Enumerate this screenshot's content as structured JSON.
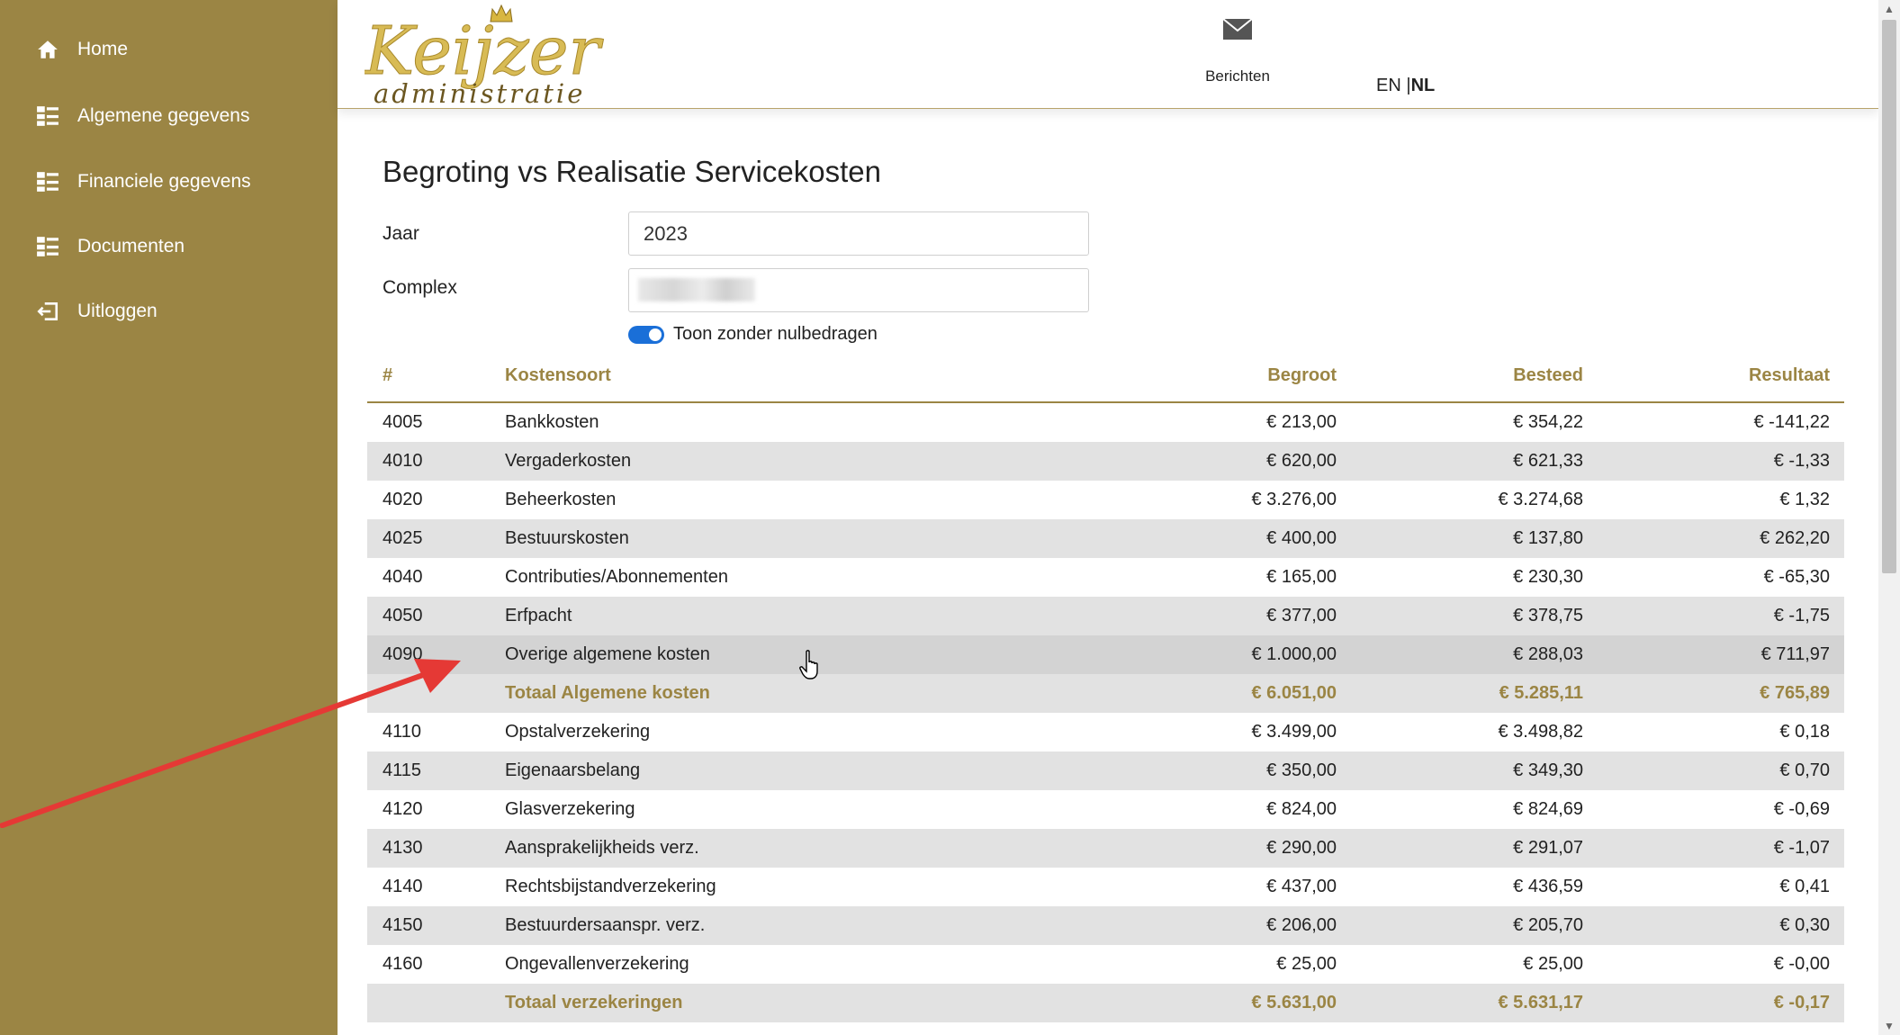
{
  "sidebar": {
    "items": [
      {
        "label": "Home",
        "icon": "home-icon"
      },
      {
        "label": "Algemene gegevens",
        "icon": "list-icon"
      },
      {
        "label": "Financiele gegevens",
        "icon": "list-icon"
      },
      {
        "label": "Documenten",
        "icon": "list-icon"
      },
      {
        "label": "Uitloggen",
        "icon": "logout-icon"
      }
    ],
    "color": "#9b8544"
  },
  "header": {
    "logo_line1": "Keijzer",
    "logo_line2": "administratie",
    "messages_label": "Berichten",
    "lang_en": "EN",
    "lang_sep": " |",
    "lang_nl": "NL"
  },
  "main": {
    "title": "Begroting vs Realisatie Servicekosten",
    "year_label": "Jaar",
    "year_value": "2023",
    "complex_label": "Complex",
    "toggle_label": "Toon zonder nulbedragen",
    "toggle_on": true
  },
  "table": {
    "headers": {
      "num": "#",
      "name": "Kostensoort",
      "begroot": "Begroot",
      "besteed": "Besteed",
      "resultaat": "Resultaat"
    },
    "rows": [
      {
        "num": "4005",
        "name": "Bankkosten",
        "begroot": "€ 213,00",
        "besteed": "€ 354,22",
        "resultaat": "€ -141,22"
      },
      {
        "num": "4010",
        "name": "Vergaderkosten",
        "begroot": "€ 620,00",
        "besteed": "€ 621,33",
        "resultaat": "€ -1,33"
      },
      {
        "num": "4020",
        "name": "Beheerkosten",
        "begroot": "€ 3.276,00",
        "besteed": "€ 3.274,68",
        "resultaat": "€ 1,32"
      },
      {
        "num": "4025",
        "name": "Bestuurskosten",
        "begroot": "€ 400,00",
        "besteed": "€ 137,80",
        "resultaat": "€ 262,20"
      },
      {
        "num": "4040",
        "name": "Contributies/Abonnementen",
        "begroot": "€ 165,00",
        "besteed": "€ 230,30",
        "resultaat": "€ -65,30"
      },
      {
        "num": "4050",
        "name": "Erfpacht",
        "begroot": "€ 377,00",
        "besteed": "€ 378,75",
        "resultaat": "€ -1,75"
      },
      {
        "num": "4090",
        "name": "Overige algemene kosten",
        "begroot": "€ 1.000,00",
        "besteed": "€ 288,03",
        "resultaat": "€ 711,97"
      },
      {
        "num": "",
        "name": "Totaal Algemene kosten",
        "begroot": "€ 6.051,00",
        "besteed": "€ 5.285,11",
        "resultaat": "€ 765,89"
      },
      {
        "num": "4110",
        "name": "Opstalverzekering",
        "begroot": "€ 3.499,00",
        "besteed": "€ 3.498,82",
        "resultaat": "€ 0,18"
      },
      {
        "num": "4115",
        "name": "Eigenaarsbelang",
        "begroot": "€ 350,00",
        "besteed": "€ 349,30",
        "resultaat": "€ 0,70"
      },
      {
        "num": "4120",
        "name": "Glasverzekering",
        "begroot": "€ 824,00",
        "besteed": "€ 824,69",
        "resultaat": "€ -0,69"
      },
      {
        "num": "4130",
        "name": "Aansprakelijkheids verz.",
        "begroot": "€ 290,00",
        "besteed": "€ 291,07",
        "resultaat": "€ -1,07"
      },
      {
        "num": "4140",
        "name": "Rechtsbijstandverzekering",
        "begroot": "€ 437,00",
        "besteed": "€ 436,59",
        "resultaat": "€ 0,41"
      },
      {
        "num": "4150",
        "name": "Bestuurdersaanspr. verz.",
        "begroot": "€ 206,00",
        "besteed": "€ 205,70",
        "resultaat": "€ 0,30"
      },
      {
        "num": "4160",
        "name": "Ongevallenverzekering",
        "begroot": "€ 25,00",
        "besteed": "€ 25,00",
        "resultaat": "€ -0,00"
      },
      {
        "num": "",
        "name": "Totaal verzekeringen",
        "begroot": "€ 5.631,00",
        "besteed": "€ 5.631,17",
        "resultaat": "€ -0,17"
      }
    ]
  },
  "colors": {
    "accent": "#9b8544",
    "toggle": "#1a6fd8",
    "annotation_arrow": "#e53935"
  }
}
